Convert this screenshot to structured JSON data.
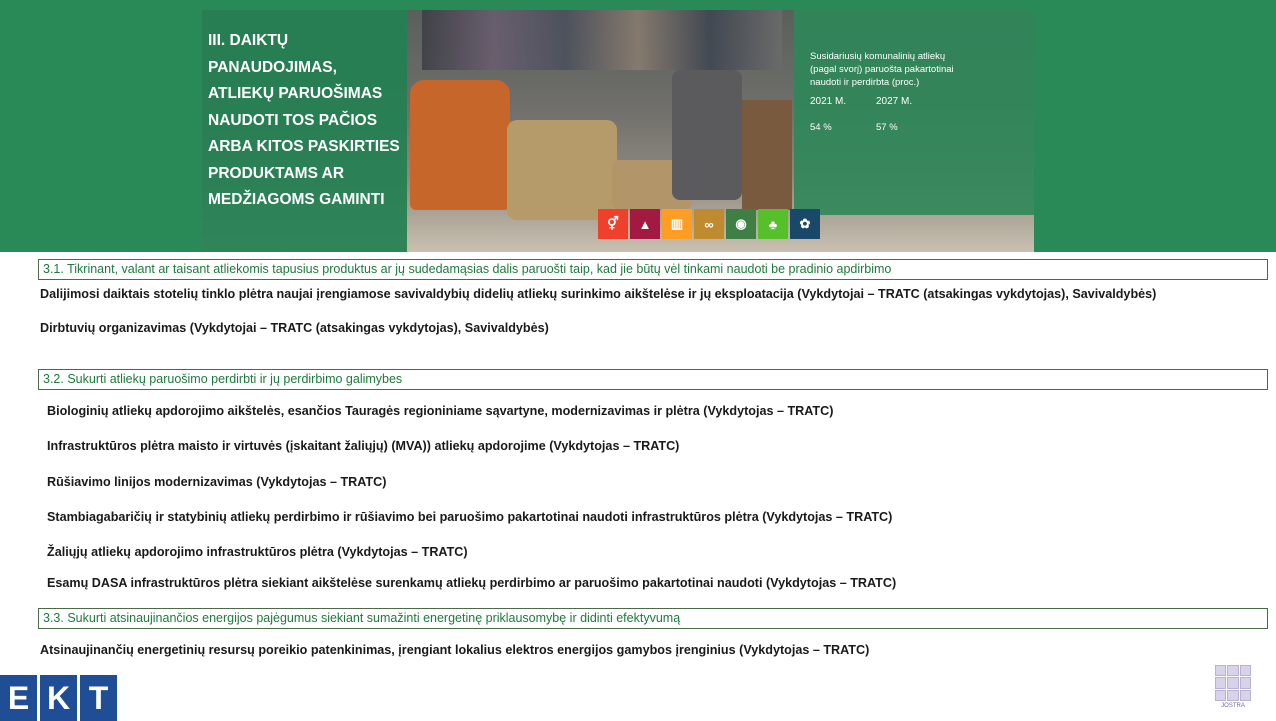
{
  "banner": {
    "title_lines": [
      "III. DAIKTŲ",
      "PANAUDOJIMAS,",
      "ATLIEKŲ PARUOŠIMAS",
      "NAUDOTI TOS PAČIOS",
      "ARBA KITOS PASKIRTIES",
      "PRODUKTAMS AR",
      "MEDŽIAGOMS GAMINTI"
    ],
    "stats": {
      "caption_lines": [
        "Susidariusių komunalinių atliekų",
        "(pagal svorį) paruošta pakartotinai",
        "naudoti ir perdirbta (proc.)"
      ],
      "years": [
        "2021 M.",
        "2027 M."
      ],
      "values": [
        "54 %",
        "57 %"
      ]
    },
    "sdg_icons": [
      {
        "number": "5",
        "icon": "gender-equality-icon",
        "glyph": "⚥",
        "color": "#ef402b"
      },
      {
        "number": "8",
        "icon": "economic-growth-icon",
        "glyph": "▲",
        "color": "#a21942"
      },
      {
        "number": "11",
        "icon": "sustainable-cities-icon",
        "glyph": "▥",
        "color": "#fd9d24"
      },
      {
        "number": "12",
        "icon": "responsible-consumption-icon",
        "glyph": "∞",
        "color": "#bf8b2e"
      },
      {
        "number": "13",
        "icon": "climate-action-icon",
        "glyph": "◉",
        "color": "#3f7e44"
      },
      {
        "number": "15",
        "icon": "life-on-land-icon",
        "glyph": "♣",
        "color": "#56c02b"
      },
      {
        "number": "17",
        "icon": "partnerships-icon",
        "glyph": "✿",
        "color": "#19486a"
      }
    ]
  },
  "objectives": [
    {
      "label": "3.1. Tikrinant, valant ar taisant atliekomis tapusius produktus ar jų sudedamąsias dalis paruošti taip, kad jie būtų vėl tinkami naudoti be pradinio apdirbimo",
      "measures": [
        "Dalijimosi daiktais stotelių tinklo plėtra naujai įrengiamose savivaldybių didelių atliekų surinkimo aikštelėse ir jų eksploatacija (Vykdytojai – TRATC (atsakingas vykdytojas), Savivaldybės)",
        "Dirbtuvių organizavimas (Vykdytojai – TRATC (atsakingas vykdytojas), Savivaldybės)"
      ]
    },
    {
      "label": "3.2. Sukurti atliekų paruošimo perdirbti ir jų perdirbimo galimybes",
      "measures": [
        "Biologinių atliekų apdorojimo aikštelės, esančios Tauragės regioniniame sąvartyne, modernizavimas ir plėtra (Vykdytojas – TRATC)",
        "Infrastruktūros plėtra maisto ir virtuvės (įskaitant žaliųjų) (MVA)) atliekų apdorojime (Vykdytojas – TRATC)",
        "Rūšiavimo linijos modernizavimas (Vykdytojas – TRATC)",
        "Stambiagabaričių ir statybinių atliekų perdirbimo ir rūšiavimo bei paruošimo pakartotinai naudoti infrastruktūros plėtra (Vykdytojas – TRATC)",
        "Žaliųjų atliekų apdorojimo infrastruktūros plėtra (Vykdytojas – TRATC)",
        "Esamų DASA infrastruktūros plėtra siekiant aikštelėse surenkamų atliekų perdirbimo ar paruošimo pakartotinai naudoti (Vykdytojas – TRATC)"
      ]
    },
    {
      "label": "3.3. Sukurti atsinaujinančios energijos pajėgumus siekiant sumažinti energetinę priklausomybę ir didinti efektyvumą",
      "measures": [
        "Atsinaujinančių energetinių resursų poreikio patenkinimas, įrengiant lokalius elektros energijos gamybos įrenginius (Vykdytojas – TRATC)"
      ]
    }
  ],
  "footer": {
    "ekt_letters": [
      "E",
      "K",
      "T"
    ],
    "ekt_logo_icon": "ekt-logo",
    "josta_label": "JOSTRA",
    "josta_icon": "josta-grid-logo"
  },
  "colors": {
    "banner_green": "#2a8a57",
    "objective_text": "#1e7a3c",
    "ekt_blue": "#1f4e96"
  }
}
